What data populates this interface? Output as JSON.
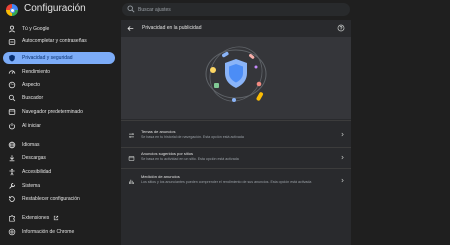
{
  "app": {
    "title": "Configuración"
  },
  "search": {
    "placeholder": "Buscar ajustes"
  },
  "sidebar": {
    "items": [
      {
        "label": "Tú y Google",
        "icon": "person-icon"
      },
      {
        "label": "Autocompletar y contraseñas",
        "icon": "key-icon"
      },
      {
        "label": "Privacidad y seguridad",
        "icon": "shield-icon",
        "active": true
      },
      {
        "label": "Rendimiento",
        "icon": "speedometer-icon"
      },
      {
        "label": "Aspecto",
        "icon": "palette-icon"
      },
      {
        "label": "Buscador",
        "icon": "search-icon"
      },
      {
        "label": "Navegador predeterminado",
        "icon": "browser-icon"
      },
      {
        "label": "Al iniciar",
        "icon": "power-icon"
      },
      {
        "label": "Idiomas",
        "icon": "globe-icon"
      },
      {
        "label": "Descargas",
        "icon": "download-icon"
      },
      {
        "label": "Accesibilidad",
        "icon": "accessibility-icon"
      },
      {
        "label": "Sistema",
        "icon": "wrench-icon"
      },
      {
        "label": "Restablecer configuración",
        "icon": "reset-icon"
      },
      {
        "label": "Extensiones",
        "icon": "puzzle-icon"
      },
      {
        "label": "Información de Chrome",
        "icon": "chrome-icon"
      }
    ]
  },
  "main": {
    "title": "Privacidad en la publicidad",
    "sections": [
      {
        "title": "Temas de anuncios",
        "description": "Se basa en tu historial de navegación. Esta opción está activada",
        "icon": "topics-icon"
      },
      {
        "title": "Anuncios sugeridos por sitios",
        "description": "Se basa en tu actividad en un sitio. Esta opción está activada",
        "icon": "site-ads-icon"
      },
      {
        "title": "Medición de anuncios",
        "description": "Los sitios y los anunciantes pueden comprender el rendimiento de sus anuncios. Esta opción está activada",
        "icon": "chart-icon"
      }
    ]
  },
  "colors": {
    "accent": "#7cacf8",
    "background": "#1f1f1f",
    "panel": "#292a2d",
    "hero": "#35363a"
  }
}
